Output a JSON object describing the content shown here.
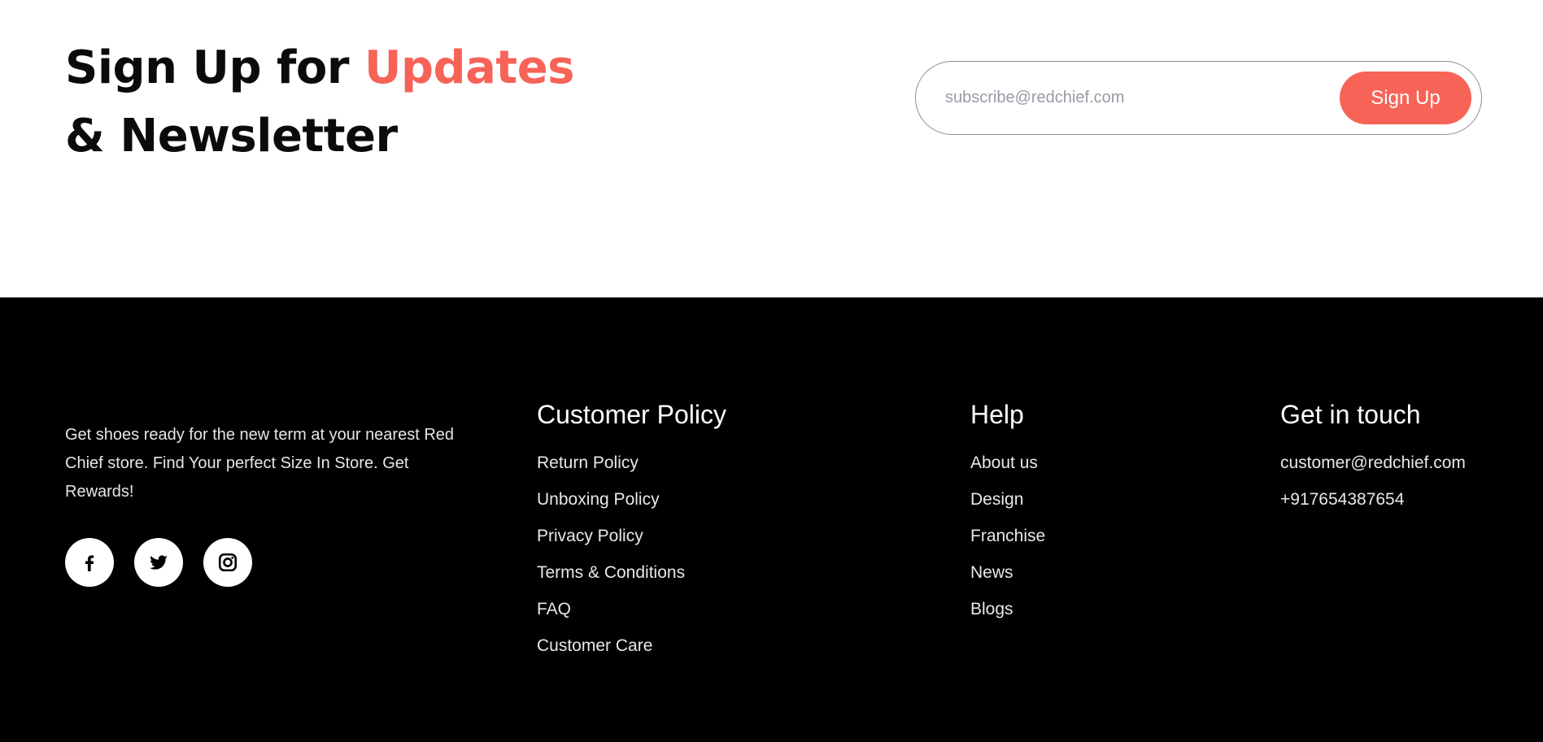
{
  "newsletter": {
    "title_part1": "Sign Up for ",
    "title_accent": "Updates",
    "title_line2": "& Newsletter",
    "email_placeholder": "subscribe@redchief.com",
    "button_label": "Sign Up",
    "accent_color": "#f76357"
  },
  "footer": {
    "background_color": "#000000",
    "about_text": "Get shoes ready for the new term at your nearest Red Chief store. Find Your perfect Size In Store. Get Rewards!",
    "socials": [
      {
        "icon": "facebook-icon"
      },
      {
        "icon": "twitter-icon"
      },
      {
        "icon": "instagram-icon"
      }
    ],
    "customer_policy": {
      "title": "Customer Policy",
      "links": [
        "Return Policy",
        "Unboxing Policy",
        "Privacy Policy",
        "Terms & Conditions",
        "FAQ",
        "Customer Care"
      ]
    },
    "help": {
      "title": "Help",
      "links": [
        "About us",
        "Design",
        "Franchise",
        "News",
        "Blogs"
      ]
    },
    "get_in_touch": {
      "title": "Get in touch",
      "email": "customer@redchief.com",
      "phone": "+917654387654"
    }
  }
}
